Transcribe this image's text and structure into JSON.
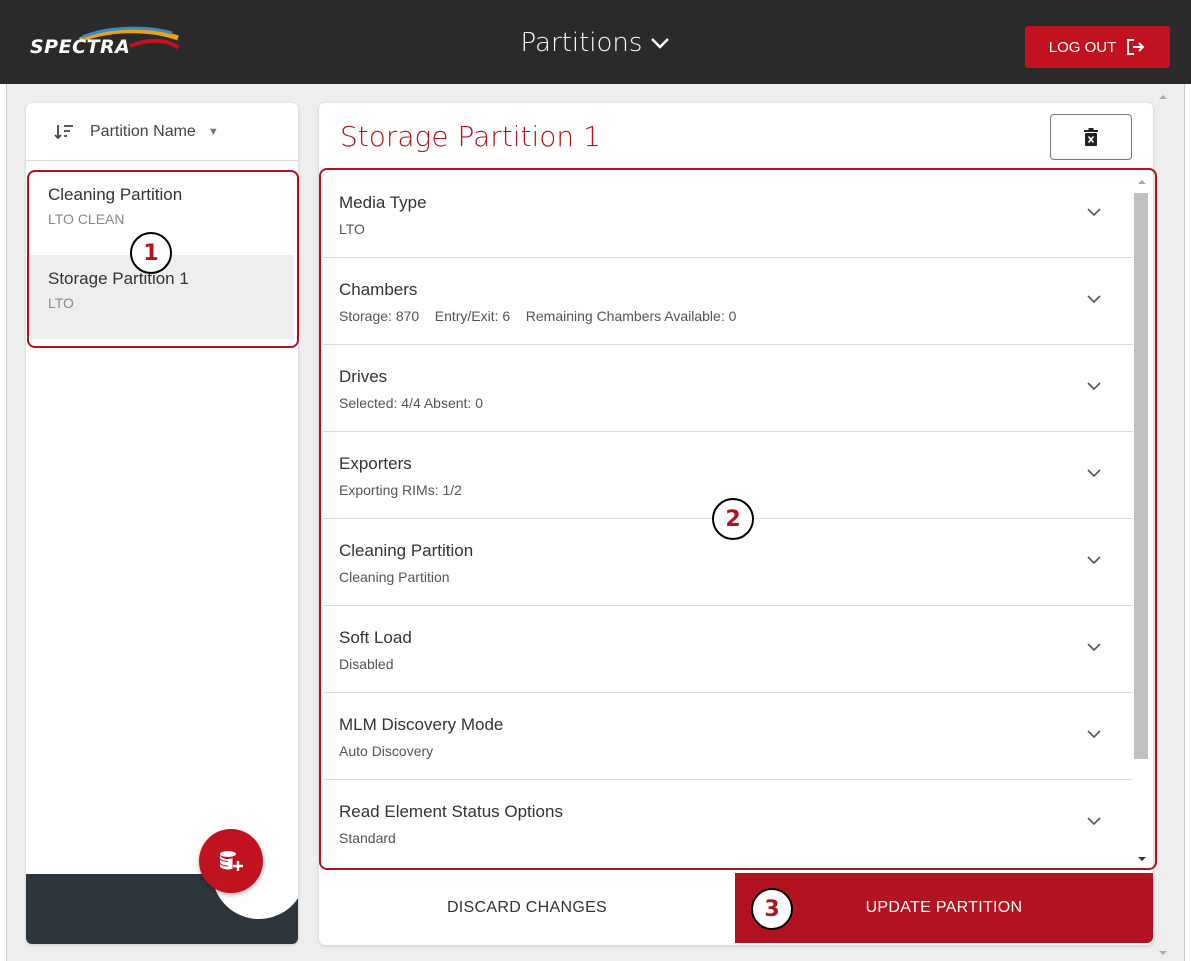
{
  "header": {
    "logo_text": "SPECTRA",
    "title": "Partitions",
    "logout_label": "LOG OUT"
  },
  "sidebar": {
    "sort_label": "Partition Name",
    "partitions": [
      {
        "name": "Cleaning Partition",
        "type": "LTO CLEAN"
      },
      {
        "name": "Storage Partition 1",
        "type": "LTO",
        "selected": true
      }
    ]
  },
  "detail": {
    "title": "Storage Partition 1",
    "sections": [
      {
        "title": "Media Type",
        "summary": "LTO"
      },
      {
        "title": "Chambers",
        "summary": "Storage: 870    Entry/Exit: 6    Remaining Chambers Available: 0"
      },
      {
        "title": "Drives",
        "summary": "Selected: 4/4 Absent: 0"
      },
      {
        "title": "Exporters",
        "summary": "Exporting RIMs: 1/2"
      },
      {
        "title": "Cleaning Partition",
        "summary": "Cleaning Partition"
      },
      {
        "title": "Soft Load",
        "summary": "Disabled"
      },
      {
        "title": "MLM Discovery Mode",
        "summary": "Auto Discovery"
      },
      {
        "title": "Read Element Status Options",
        "summary": "Standard"
      }
    ]
  },
  "actions": {
    "discard_label": "DISCARD CHANGES",
    "update_label": "UPDATE PARTITION"
  },
  "callouts": [
    "1",
    "2",
    "3"
  ],
  "colors": {
    "accent": "#c1121f",
    "header_bg": "#2a2a2a",
    "sidebar_footer": "#2d353c"
  },
  "icons": [
    "chevron-down-icon",
    "logout-icon",
    "sort-icon",
    "delete-icon",
    "add-partition-icon"
  ]
}
